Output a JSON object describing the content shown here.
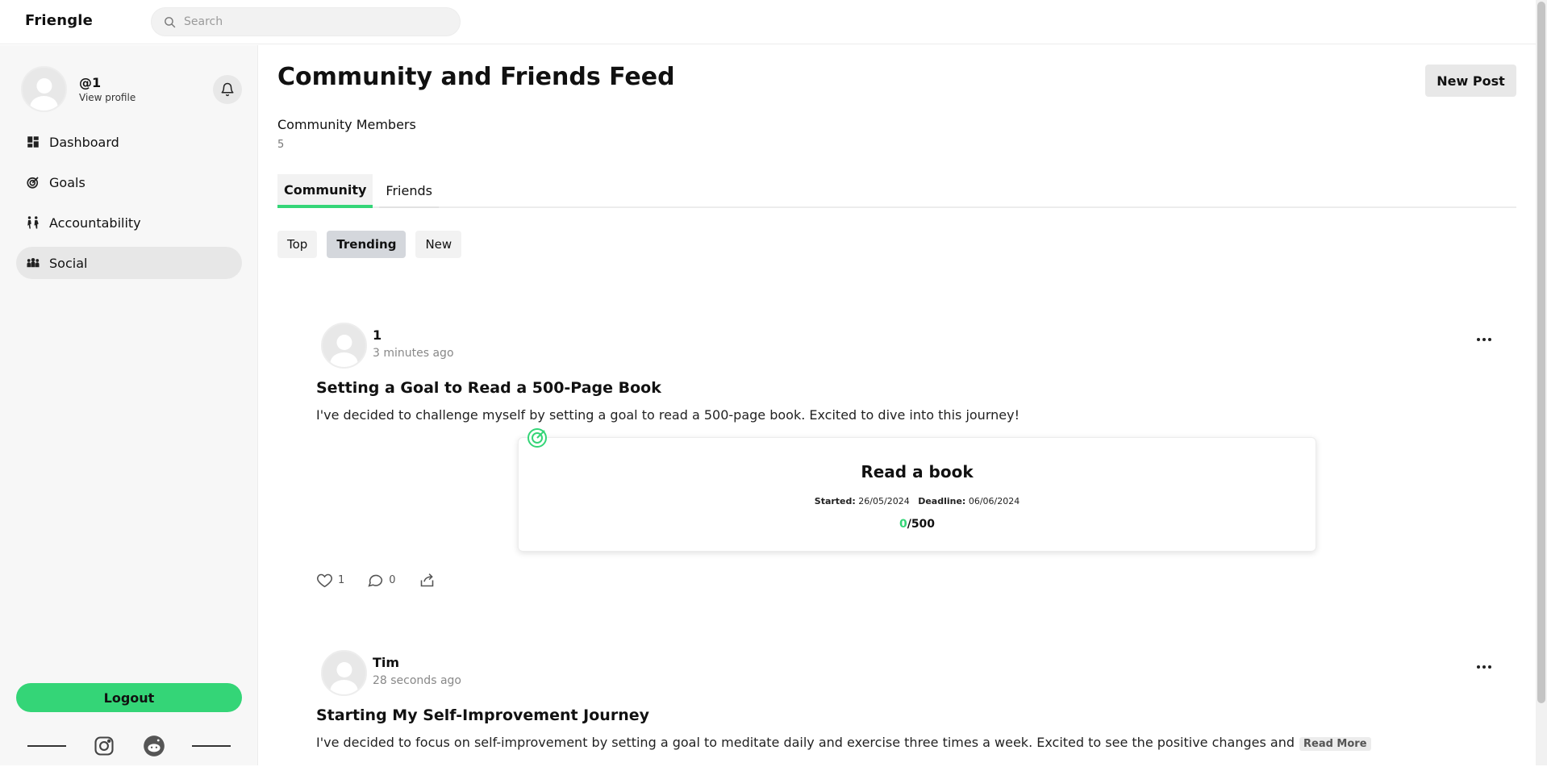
{
  "app": {
    "brand": "Friengle"
  },
  "search": {
    "placeholder": "Search"
  },
  "profile": {
    "handle": "@1",
    "view_profile": "View profile"
  },
  "sidebar": {
    "items": [
      {
        "label": "Dashboard",
        "icon": "dashboard-icon",
        "active": false
      },
      {
        "label": "Goals",
        "icon": "target-icon",
        "active": false
      },
      {
        "label": "Accountability",
        "icon": "people-walking-icon",
        "active": false
      },
      {
        "label": "Social",
        "icon": "group-icon",
        "active": true
      }
    ],
    "logout_label": "Logout",
    "social_icons": [
      "instagram-icon",
      "reddit-icon"
    ]
  },
  "main": {
    "title": "Community and Friends Feed",
    "new_post_label": "New Post",
    "members_label": "Community Members",
    "members_count": "5",
    "tabs": [
      {
        "label": "Community",
        "active": true
      },
      {
        "label": "Friends",
        "active": false
      }
    ],
    "filters": [
      {
        "label": "Top",
        "active": false
      },
      {
        "label": "Trending",
        "active": true
      },
      {
        "label": "New",
        "active": false
      }
    ]
  },
  "posts": [
    {
      "author": "1",
      "time": "3 minutes ago",
      "title": "Setting a Goal to Read a 500-Page Book",
      "body": "I've decided to challenge myself by setting a goal to read a 500-page book. Excited to dive into this journey!",
      "goal": {
        "title": "Read a book",
        "started_label": "Started:",
        "started": "26/05/2024",
        "deadline_label": "Deadline:",
        "deadline": "06/06/2024",
        "current": "0",
        "total": "/500"
      },
      "likes": "1",
      "comments": "0"
    },
    {
      "author": "Tim",
      "time": "28 seconds ago",
      "title": "Starting My Self-Improvement Journey",
      "body": "I've decided to focus on self-improvement by setting a goal to meditate daily and exercise three times a week. Excited to see the positive changes and",
      "read_more": "Read More"
    }
  ],
  "colors": {
    "accent": "#34d577",
    "active_filter": "#d4d7dc",
    "sidebar_bg": "#f7f7f7"
  }
}
